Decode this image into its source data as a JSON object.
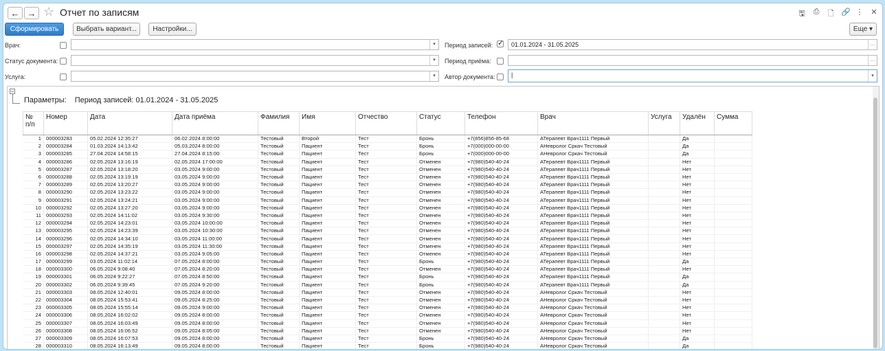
{
  "window": {
    "title": "Отчет по записям"
  },
  "toolbar": {
    "generate": "Сформировать",
    "choose_variant": "Выбрать вариант...",
    "settings": "Настройки...",
    "more": "Еще"
  },
  "filters": {
    "doctor": {
      "label": "Врач:",
      "checked": false,
      "value": ""
    },
    "doc_status": {
      "label": "Статус документа:",
      "checked": false,
      "value": ""
    },
    "service": {
      "label": "Услуга:",
      "checked": false,
      "value": ""
    },
    "record_period": {
      "label": "Период записей:",
      "checked": true,
      "value": "01.01.2024 - 31.05.2025"
    },
    "appointment_period": {
      "label": "Период приёма:",
      "checked": false,
      "value": ""
    },
    "doc_author": {
      "label": "Автор документа:",
      "checked": false,
      "value": "|"
    }
  },
  "report": {
    "params_label": "Параметры:",
    "params_value": "Период записей: 01.01.2024 - 31.05.2025",
    "columns": [
      "№\nп/п",
      "Номер",
      "Дата",
      "Дата приёма",
      "Фамилия",
      "Имя",
      "Отчество",
      "Статус",
      "Телефон",
      "Врач",
      "Услуга",
      "Удалён",
      "Сумма"
    ],
    "rows": [
      [
        "1",
        "000003283",
        "05.02.2024 12:35:27",
        "06.02.2024 8:00:00",
        "Тестовый",
        "Второй",
        "Тест",
        "Бронь",
        "+7(856)856-85-68",
        "АТерапевт Врач1111 Первый",
        "",
        "Да",
        ""
      ],
      [
        "2",
        "000003284",
        "01.03.2024 14:13:42",
        "05.03.2024 8:00:00",
        "Тестовый",
        "Пациент",
        "Тест",
        "Бронь",
        "+7(000)000-00-00",
        "АНевролог Сркач Тестовый",
        "",
        "Да",
        ""
      ],
      [
        "3",
        "000003285",
        "27.04.2024 14:58:15",
        "27.04.2024 8:15:00",
        "Тестовый",
        "Пациент",
        "Тест",
        "Бронь",
        "+7(000)000-00-00",
        "АНевролог Сркач Тестовый",
        "",
        "Да",
        ""
      ],
      [
        "4",
        "000003286",
        "02.05.2024 13:16:19",
        "02.05.2024 17:00:00",
        "Тестовый",
        "Пациент",
        "Тест",
        "Отменен",
        "+7(980)540-40-24",
        "АТерапевт Врач1111 Первый",
        "",
        "Нет",
        ""
      ],
      [
        "5",
        "000003287",
        "02.05.2024 13:18:20",
        "03.05.2024 9:00:00",
        "Тестовый",
        "Пациент",
        "Тест",
        "Отменен",
        "+7(980)540-40-24",
        "АТерапевт Врач1111 Первый",
        "",
        "Нет",
        ""
      ],
      [
        "6",
        "000003288",
        "02.05.2024 13:19:19",
        "03.05.2024 9:00:00",
        "Тестовый",
        "Пациент",
        "Тест",
        "Отменен",
        "+7(980)540-40-24",
        "АТерапевт Врач1111 Первый",
        "",
        "Нет",
        ""
      ],
      [
        "7",
        "000003289",
        "02.05.2024 13:20:27",
        "03.05.2024 9:00:00",
        "Тестовый",
        "Пациент",
        "Тест",
        "Отменен",
        "+7(980)540-40-24",
        "АТерапевт Врач1111 Первый",
        "",
        "Нет",
        ""
      ],
      [
        "8",
        "000003290",
        "02.05.2024 13:23:22",
        "03.05.2024 9:00:00",
        "Тестовый",
        "Пациент",
        "Тест",
        "Отменен",
        "+7(980)540-40-24",
        "АТерапевт Врач1111 Первый",
        "",
        "Нет",
        ""
      ],
      [
        "9",
        "000003291",
        "02.05.2024 13:24:21",
        "03.05.2024 9:00:00",
        "Тестовый",
        "Пациент",
        "Тест",
        "Отменен",
        "+7(980)540-40-24",
        "АТерапевт Врач1111 Первый",
        "",
        "Нет",
        ""
      ],
      [
        "10",
        "000003292",
        "02.05.2024 13:27:20",
        "03.05.2024 9:00:00",
        "Тестовый",
        "Пациент",
        "Тест",
        "Отменен",
        "+7(980)540-40-24",
        "АТерапевт Врач1111 Первый",
        "",
        "Нет",
        ""
      ],
      [
        "11",
        "000003293",
        "02.05.2024 14:11:02",
        "03.05.2024 9:30:00",
        "Тестовый",
        "Пациент",
        "Тест",
        "Отменен",
        "+7(980)540-40-24",
        "АТерапевт Врач1111 Первый",
        "",
        "Нет",
        ""
      ],
      [
        "12",
        "000003294",
        "02.05.2024 14:23:01",
        "03.05.2024 10:00:00",
        "Тестовый",
        "Пациент",
        "Тест",
        "Отменен",
        "+7(980)540-40-24",
        "АТерапевт Врач1111 Первый",
        "",
        "Нет",
        ""
      ],
      [
        "13",
        "000003295",
        "02.05.2024 14:23:39",
        "03.05.2024 10:30:00",
        "Тестовый",
        "Пациент",
        "Тест",
        "Отменен",
        "+7(980)540-40-24",
        "АТерапевт Врач1111 Первый",
        "",
        "Нет",
        ""
      ],
      [
        "14",
        "000003296",
        "02.05.2024 14:34:10",
        "03.05.2024 11:00:00",
        "Тестовый",
        "Пациент",
        "Тест",
        "Отменен",
        "+7(980)540-40-24",
        "АТерапевт Врач1111 Первый",
        "",
        "Нет",
        ""
      ],
      [
        "15",
        "000003297",
        "02.05.2024 14:35:19",
        "03.05.2024 11:30:00",
        "Тестовый",
        "Пациент",
        "Тест",
        "Отменен",
        "+7(980)540-40-24",
        "АТерапевт Врач1111 Первый",
        "",
        "Нет",
        ""
      ],
      [
        "16",
        "000003298",
        "02.05.2024 14:37:21",
        "03.05.2024 9:05:00",
        "Тестовый",
        "Пациент",
        "Тест",
        "Отменен",
        "+7(980)540-40-24",
        "АТерапевт Врач1111 Первый",
        "",
        "Нет",
        ""
      ],
      [
        "17",
        "000003299",
        "03.05.2024 11:02:14",
        "07.05.2024 8:00:00",
        "Тестовый",
        "Пациент",
        "Тест",
        "Бронь",
        "+7(980)540-40-24",
        "АТерапевт Врач1111 Первый",
        "",
        "Да",
        ""
      ],
      [
        "18",
        "000003300",
        "06.05.2024 9:08:40",
        "07.05.2024 8:20:00",
        "Тестовый",
        "Пациент",
        "Тест",
        "Отменен",
        "+7(980)540-40-24",
        "АТерапевт Врач1111 Первый",
        "",
        "Нет",
        ""
      ],
      [
        "19",
        "000003301",
        "06.05.2024 9:22:27",
        "07.05.2024 8:50:00",
        "Тестовый",
        "Пациент",
        "Тест",
        "Бронь",
        "+7(980)540-40-24",
        "АТерапевт Врач1111 Первый",
        "",
        "Да",
        ""
      ],
      [
        "20",
        "000003302",
        "06.05.2024 9:39:45",
        "07.05.2024 9:20:00",
        "Тестовый",
        "Пациент",
        "Тест",
        "Бронь",
        "+7(980)540-40-24",
        "АТерапевт Врач1111 Первый",
        "",
        "Да",
        ""
      ],
      [
        "21",
        "000003303",
        "08.05.2024 12:40:01",
        "09.05.2024 8:00:00",
        "Тестовый",
        "Пациент",
        "Тест",
        "Отменен",
        "+7(980)540-40-24",
        "АНевролог Сркач Тестовый",
        "",
        "Нет",
        ""
      ],
      [
        "22",
        "000003304",
        "08.05.2024 15:53:41",
        "09.05.2024 8:25:00",
        "Тестовый",
        "Пациент",
        "Тест",
        "Отменен",
        "+7(980)540-40-24",
        "АНевролог Сркач Тестовый",
        "",
        "Нет",
        ""
      ],
      [
        "23",
        "000003305",
        "08.05.2024 15:55:14",
        "09.05.2024 9:00:00",
        "Тестовый",
        "Пациент",
        "Тест",
        "Отменен",
        "+7(980)540-40-24",
        "АНевролог Сркач Тестовый",
        "",
        "Нет",
        ""
      ],
      [
        "24",
        "000003306",
        "08.05.2024 16:02:02",
        "09.05.2024 8:00:00",
        "Тестовый",
        "Пациент",
        "Тест",
        "Отменен",
        "+7(980)540-40-24",
        "АНевролог Сркач Тестовый",
        "",
        "Нет",
        ""
      ],
      [
        "25",
        "000003307",
        "08.05.2024 16:03:49",
        "09.05.2024 8:00:00",
        "Тестовый",
        "Пациент",
        "Тест",
        "Отменен",
        "+7(980)540-40-24",
        "АНевролог Сркач Тестовый",
        "",
        "Нет",
        ""
      ],
      [
        "26",
        "000003308",
        "08.05.2024 16:06:52",
        "09.05.2024 8:05:00",
        "Тестовый",
        "Пациент",
        "Тест",
        "Отменен",
        "+7(980)540-40-24",
        "АНевролог Сркач Тестовый",
        "",
        "Нет",
        ""
      ],
      [
        "27",
        "000003309",
        "08.05.2024 16:07:53",
        "09.05.2024 8:00:00",
        "Тестовый",
        "Пациент",
        "Тест",
        "Бронь",
        "+7(980)540-40-24",
        "АНевролог Сркач Тестовый",
        "",
        "Да",
        ""
      ],
      [
        "28",
        "000003310",
        "08.05.2024 16:13:49",
        "09.05.2024 8:00:00",
        "Тестовый",
        "Пациент",
        "Тест",
        "Бронь",
        "+7(980)540-40-24",
        "АНевролог Сркач Тестовый",
        "",
        "Да",
        ""
      ]
    ]
  }
}
